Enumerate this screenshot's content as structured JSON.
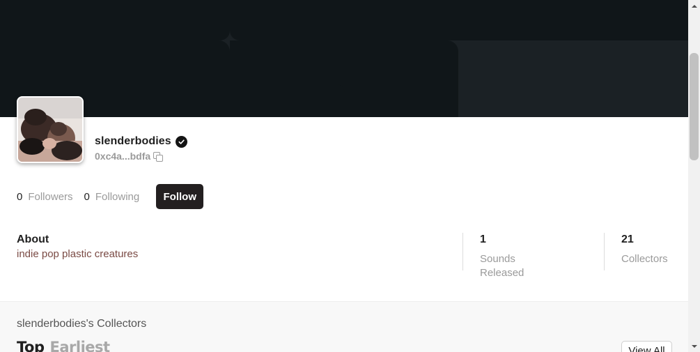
{
  "profile": {
    "username": "slenderbodies",
    "wallet": "0xc4a...bdfa",
    "followers": {
      "count": "0",
      "label": "Followers"
    },
    "following": {
      "count": "0",
      "label": "Following"
    },
    "follow_label": "Follow"
  },
  "about": {
    "heading": "About",
    "text": "indie pop plastic creatures"
  },
  "metrics": [
    {
      "value": "1",
      "label_line1": "Sounds",
      "label_line2": "Released"
    },
    {
      "value": "21",
      "label_line1": "Collectors"
    }
  ],
  "collectors": {
    "title": "slenderbodies's Collectors",
    "tabs": [
      "Top",
      "Earliest"
    ],
    "view_all_label": "View All"
  },
  "colors": {
    "banner": "#1b2125",
    "banner_accent": "#101619",
    "follow_button": "#231f20"
  }
}
